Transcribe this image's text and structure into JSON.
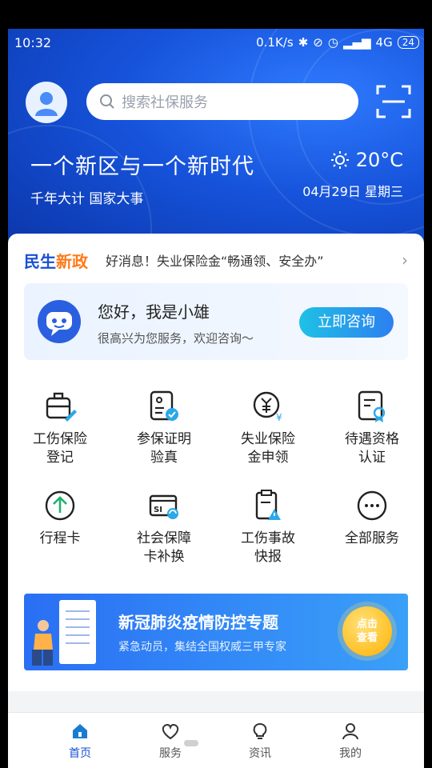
{
  "status": {
    "time": "10:32",
    "net_speed": "0.1K/s",
    "network": "4G",
    "battery": "24"
  },
  "header": {
    "search_placeholder": "搜索社保服务",
    "slogan": "一个新区与一个新时代",
    "subtitle": "千年大计 国家大事",
    "temperature": "20°C",
    "date": "04月29日 星期三"
  },
  "news": {
    "tag_part1": "民生",
    "tag_part2": "新政",
    "headline": "好消息！失业保险金“畅通领、安全办”"
  },
  "assistant": {
    "greeting": "您好，我是小雄",
    "subtitle": "很高兴为您服务，欢迎咨询～",
    "button": "立即咨询"
  },
  "services": [
    {
      "line1": "工伤保险",
      "line2": "登记",
      "icon": "briefcase-pen-icon"
    },
    {
      "line1": "参保证明",
      "line2": "验真",
      "icon": "certificate-check-icon"
    },
    {
      "line1": "失业保险",
      "line2": "金申领",
      "icon": "money-claim-icon"
    },
    {
      "line1": "待遇资格",
      "line2": "认证",
      "icon": "qualification-badge-icon"
    },
    {
      "line1": "行程卡",
      "line2": "",
      "icon": "arrow-up-circle-icon"
    },
    {
      "line1": "社会保障",
      "line2": "卡补换",
      "icon": "si-card-icon"
    },
    {
      "line1": "工伤事故",
      "line2": "快报",
      "icon": "accident-report-icon"
    },
    {
      "line1": "全部服务",
      "line2": "",
      "icon": "more-icon"
    }
  ],
  "banner": {
    "title": "新冠肺炎疫情防控专题",
    "subtitle": "紧急动员，集结全国权威三甲专家",
    "badge_line1": "点击",
    "badge_line2": "查看"
  },
  "tabs": [
    {
      "label": "首页",
      "icon": "home-icon",
      "active": true
    },
    {
      "label": "服务",
      "icon": "heart-icon",
      "active": false
    },
    {
      "label": "资讯",
      "icon": "lightbulb-icon",
      "active": false
    },
    {
      "label": "我的",
      "icon": "user-icon",
      "active": false
    }
  ],
  "colors": {
    "primary": "#1a4fd3",
    "accent": "#ff7a1a",
    "banner": "#2a6ff4"
  }
}
